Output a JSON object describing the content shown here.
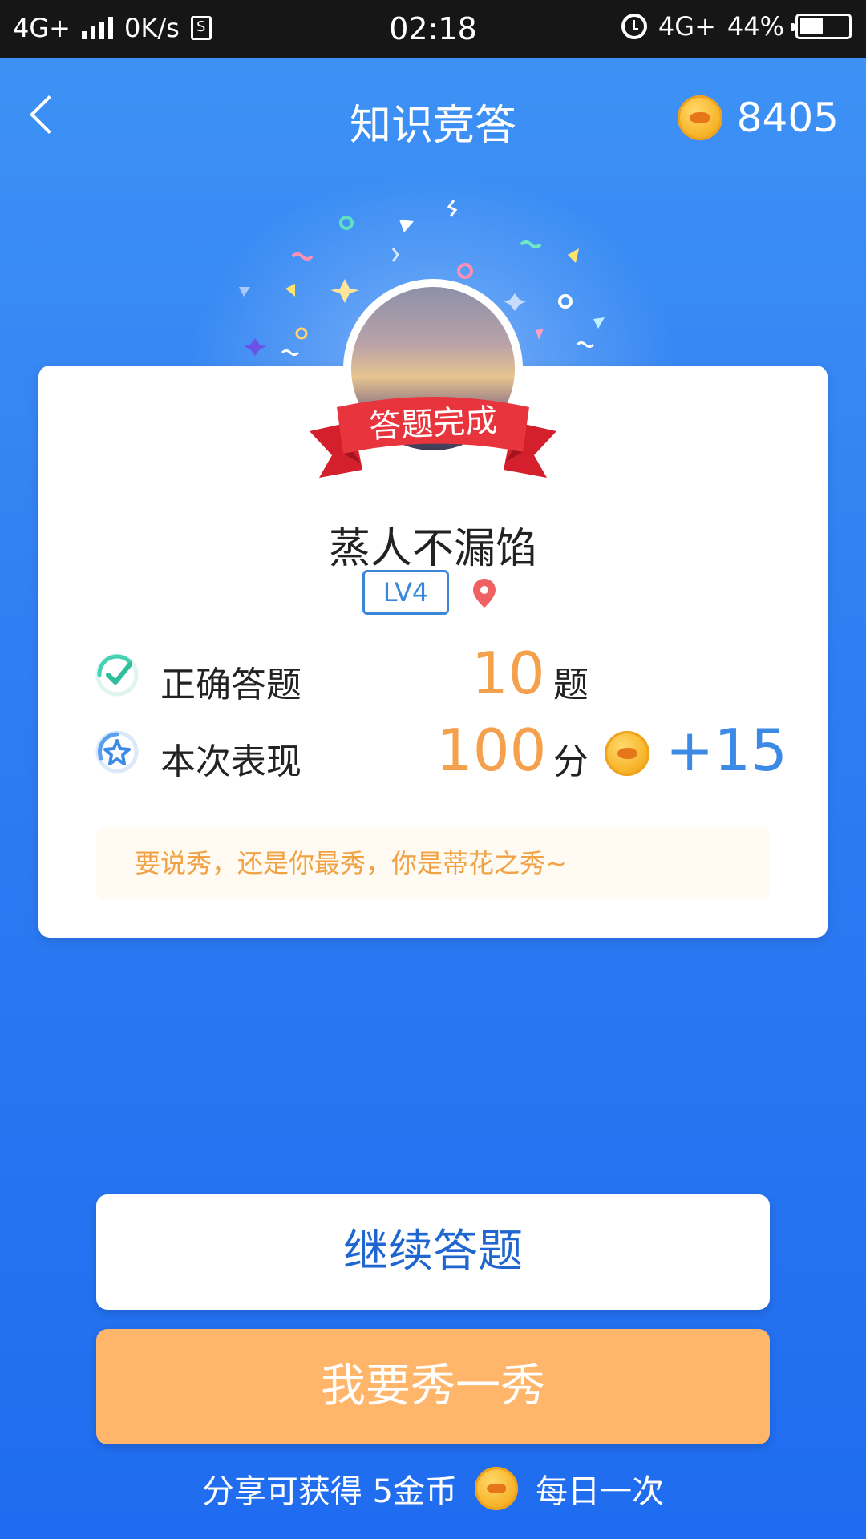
{
  "status_bar": {
    "network_left": "4G+",
    "speed": "0K/s",
    "sim_glyph": "S",
    "time": "02:18",
    "network_right": "4G+",
    "battery": "44%"
  },
  "header": {
    "title": "知识竞答",
    "coin_balance": "8405"
  },
  "result": {
    "ribbon_text": "答题完成",
    "username": "蒸人不漏馅",
    "level": "LV4"
  },
  "stats": [
    {
      "label": "正确答题",
      "value": "10",
      "unit": "题"
    },
    {
      "label": "本次表现",
      "value": "100",
      "unit": "分",
      "bonus": "+15"
    }
  ],
  "quote": "要说秀，还是你最秀，你是蒂花之秀~",
  "buttons": {
    "continue": "继续答题",
    "show_off": "我要秀一秀"
  },
  "share_note": {
    "before": "分享可获得 5金币",
    "after": "每日一次"
  },
  "icons": {
    "back": "chevron-left-icon",
    "coin": "fish-coin-icon",
    "check": "check-circle-icon",
    "star": "star-circle-icon",
    "location": "location-pin-icon"
  },
  "colors": {
    "background": "#2f7df2",
    "accent_orange": "#f4a04c",
    "bonus_blue": "#3d8ae6",
    "ribbon_red": "#e8353d",
    "button_orange": "#ffb56a"
  }
}
